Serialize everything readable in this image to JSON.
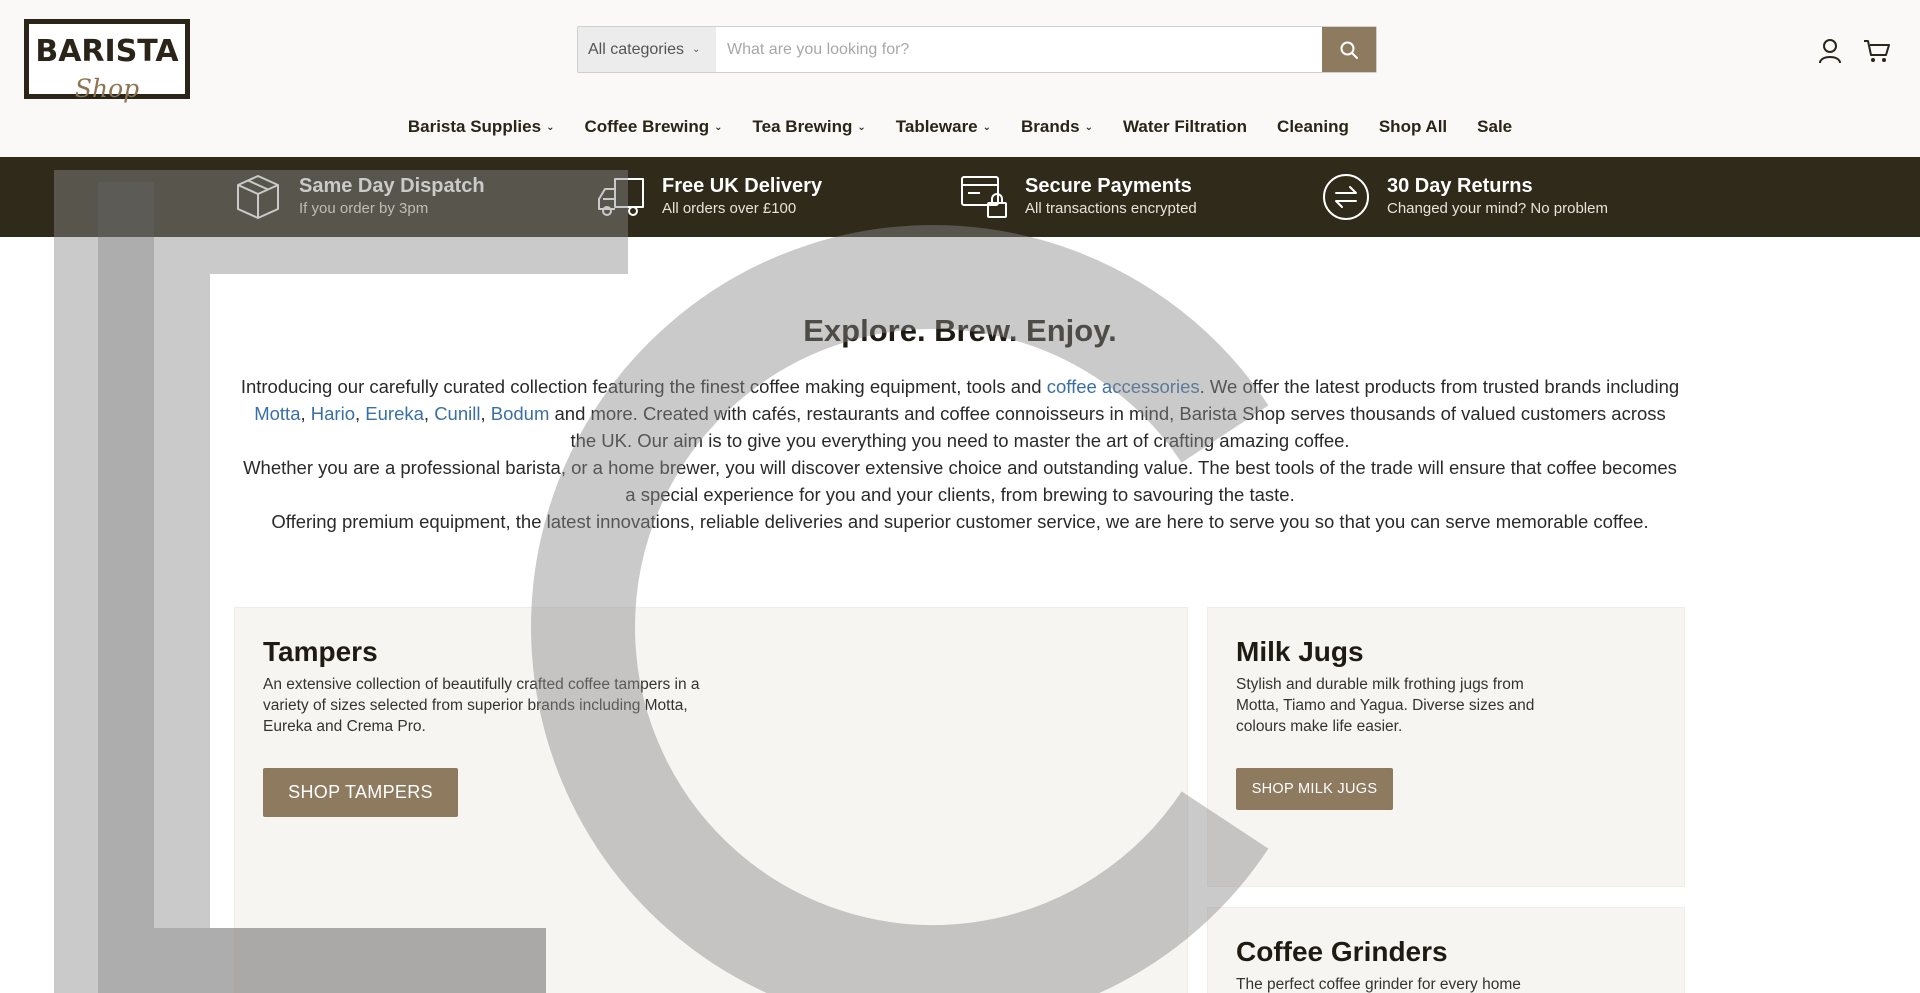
{
  "header": {
    "logo_line1": "BARISTA",
    "logo_line2": "Shop",
    "search": {
      "category": "All categories",
      "placeholder": "What are you looking for?"
    },
    "icons": [
      "search-icon",
      "account-icon",
      "cart-icon"
    ]
  },
  "nav": {
    "items": [
      {
        "label": "Barista Supplies",
        "dropdown": true
      },
      {
        "label": "Coffee Brewing",
        "dropdown": true
      },
      {
        "label": "Tea Brewing",
        "dropdown": true
      },
      {
        "label": "Tableware",
        "dropdown": true
      },
      {
        "label": "Brands",
        "dropdown": true
      },
      {
        "label": "Water Filtration",
        "dropdown": false
      },
      {
        "label": "Cleaning",
        "dropdown": false
      },
      {
        "label": "Shop All",
        "dropdown": false
      },
      {
        "label": "Sale",
        "dropdown": false
      }
    ]
  },
  "benefits": [
    {
      "title": "Same Day Dispatch",
      "subtitle": "If you order by 3pm",
      "icon": "box-icon"
    },
    {
      "title": "Free UK Delivery",
      "subtitle": "All orders over £100",
      "icon": "truck-icon"
    },
    {
      "title": "Secure Payments",
      "subtitle": "All transactions encrypted",
      "icon": "secure-card-icon"
    },
    {
      "title": "30 Day Returns",
      "subtitle": "Changed your mind? No problem",
      "icon": "returns-icon"
    }
  ],
  "intro": {
    "title": "Explore. Brew. Enjoy.",
    "p1_a": "Introducing our carefully curated collection featuring the finest coffee making equipment, tools and ",
    "p1_link": "coffee accessories",
    "p1_b": ". We offer the latest products from trusted brands including ",
    "brands": [
      "Motta",
      "Hario",
      "Eureka",
      "Cunill",
      "Bodum"
    ],
    "p1_c": " and more. Created with cafés, restaurants and coffee connoisseurs in mind, Barista Shop serves thousands of valued customers across the UK. Our aim is to give you everything you need to master the art of crafting amazing coffee.",
    "p2": "Whether you are a professional barista, or a home brewer, you will discover extensive choice and outstanding value. The best tools of the trade will ensure that coffee becomes a special experience for you and your clients, from brewing to savouring the taste.",
    "p3": "Offering premium equipment, the latest innovations, reliable deliveries and superior customer service, we are here to serve you so that you can serve memorable coffee."
  },
  "cards": {
    "tampers": {
      "title": "Tampers",
      "text": "An extensive collection of beautifully crafted coffee tampers in a variety of sizes selected from superior brands including Motta, Eureka and Crema Pro.",
      "button": "SHOP TAMPERS"
    },
    "milk_jugs": {
      "title": "Milk Jugs",
      "text": "Stylish and durable milk frothing jugs from Motta, Tiamo and Yagua. Diverse sizes and colours make life easier.",
      "button": "SHOP MILK JUGS"
    },
    "grinders": {
      "title": "Coffee Grinders",
      "text": "The perfect coffee grinder for every home"
    }
  },
  "colors": {
    "benefits_bg": "#2f2a1a",
    "accent": "#8d7a5f",
    "link": "#3a6fa6"
  }
}
